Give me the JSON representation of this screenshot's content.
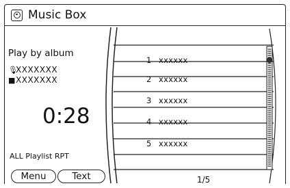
{
  "header": {
    "title": "Music Box",
    "icon": "music-box-icon"
  },
  "left_panel": {
    "play_mode": "Play by album",
    "artist_icon": "microphone-icon",
    "artist": "XXXXXXX",
    "album_icon": "square-icon",
    "album": "XXXXXXX",
    "elapsed_time": "0:28",
    "repeat_status": "ALL Playlist RPT"
  },
  "buttons": {
    "menu_label": "Menu",
    "text_label": "Text"
  },
  "track_list": {
    "items": [
      {
        "number": "1",
        "title": "xxxxxx"
      },
      {
        "number": "2",
        "title": "xxxxxx"
      },
      {
        "number": "3",
        "title": "xxxxxx"
      },
      {
        "number": "4",
        "title": "xxxxxx"
      },
      {
        "number": "5",
        "title": "xxxxxx"
      }
    ],
    "page_indicator": "1/5",
    "scroll_position": 0.0
  }
}
